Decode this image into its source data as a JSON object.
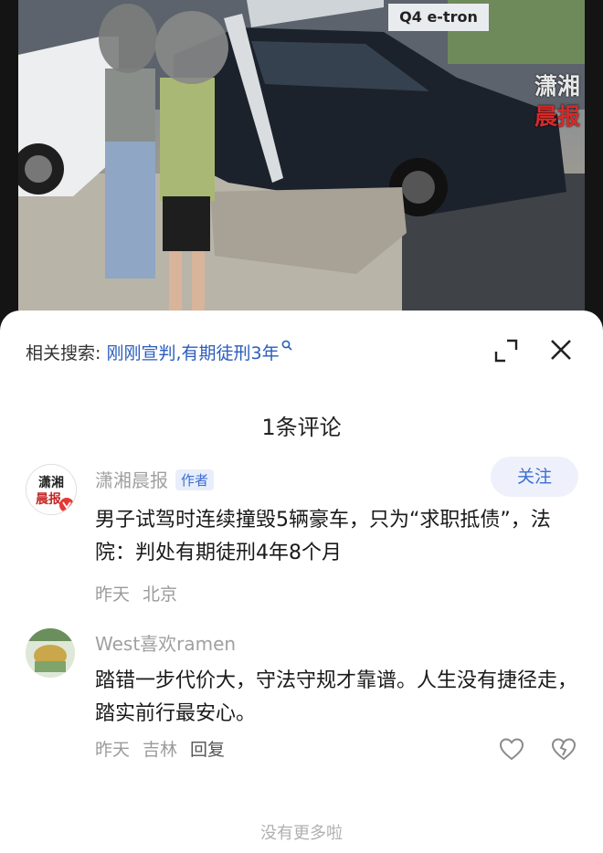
{
  "video": {
    "sign_text": "Q4 e-tron",
    "watermark_line1": "潇湘",
    "watermark_line2": "晨报"
  },
  "related_search": {
    "label": "相关搜索:",
    "query": "刚刚宣判,有期徒刑3年"
  },
  "comments_header": {
    "count_label": "1条评论"
  },
  "comments": [
    {
      "username": "潇湘晨报",
      "badge": "作者",
      "follow_label": "关注",
      "avatar_text_1": "潇湘",
      "avatar_text_2": "晨报",
      "text": "男子试驾时连续撞毁5辆豪车，只为“求职抵债”，法院：判处有期徒刑4年8个月",
      "time": "昨天",
      "location": "北京"
    },
    {
      "username": "West喜欢ramen",
      "text": "踏错一步代价大，守法守规才靠谱。人生没有捷径走，踏实前行最安心。",
      "time": "昨天",
      "location": "吉林",
      "reply_label": "回复"
    }
  ],
  "footer": {
    "no_more": "没有更多啦"
  },
  "colors": {
    "link": "#2a5dbd",
    "accent": "#3b6fd1",
    "follow_bg": "#eef1fb",
    "muted": "#9b9b9b"
  },
  "icons": [
    "search-icon",
    "expand-icon",
    "close-icon",
    "like-icon",
    "dislike-icon"
  ]
}
